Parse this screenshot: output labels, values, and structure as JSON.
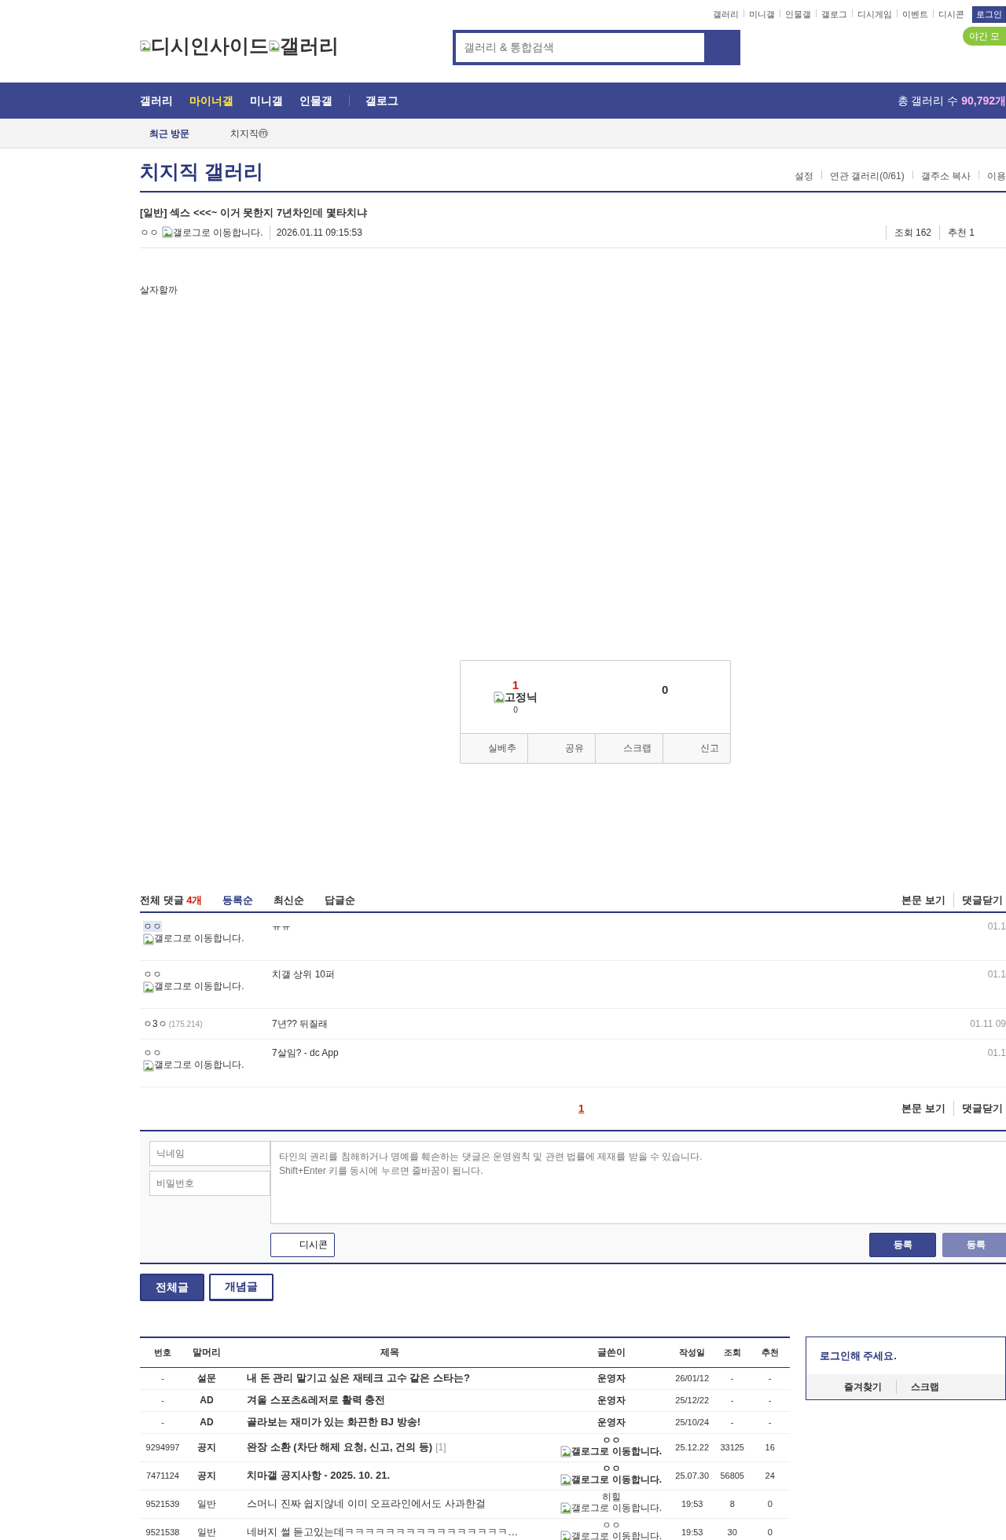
{
  "header": {
    "logo_alt": "디시인사이드",
    "logo_alt_2": "갤러리",
    "search": {
      "placeholder": "갤러리 & 통합검색"
    },
    "top_links": [
      "갤러리",
      "미니갤",
      "인물갤",
      "갤로그",
      "디시게임",
      "이벤트",
      "디시콘"
    ],
    "login": "로그인",
    "night_mode": "야간 모"
  },
  "nav": {
    "items": [
      {
        "label": "갤러리",
        "selected": false
      },
      {
        "label": "마이너갤",
        "selected": true
      },
      {
        "label": "미니갤",
        "selected": false
      },
      {
        "label": "인물갤",
        "selected": false
      },
      {
        "label": "갤로그",
        "selected": false
      }
    ],
    "count_label": "총 갤러리 수",
    "count": "90,792개"
  },
  "recent": {
    "label": "최근 방문",
    "items": [
      "치지직ⓜ"
    ]
  },
  "gallery": {
    "title": "치지직 갤러리",
    "menu": [
      "설정",
      "연관 갤러리(0/61)",
      "갤주소 복사",
      "이용"
    ]
  },
  "post": {
    "title": "[일반] 섹스 <<<~ 이거 못한지 7년차인데 몇타치냐",
    "author": "ㅇㅇ",
    "author_badge": "갤로그로 이동합니다.",
    "date": "2026.01.11 09:15:53",
    "views": "조회 162",
    "recommends": "추천 1",
    "body": "살자할까"
  },
  "recommend": {
    "up_count": "1",
    "fixed_nick": "고정닉",
    "fixed_count": "0",
    "down_count": "0",
    "buttons": [
      "실베추",
      "공유",
      "스크랩",
      "신고"
    ]
  },
  "comments": {
    "total_label": "전체 댓글",
    "count": "4개",
    "sorts": [
      {
        "label": "등록순",
        "selected": true
      },
      {
        "label": "최신순",
        "selected": false
      },
      {
        "label": "답글순",
        "selected": false
      }
    ],
    "links": [
      "본문 보기",
      "댓글닫기"
    ],
    "items": [
      {
        "author": "ㅇㅇ",
        "badge": "갤로그로 이동합니다.",
        "highlighted": true,
        "text": "ㅠㅠ",
        "date": "01.1"
      },
      {
        "author": "ㅇㅇ",
        "badge": "갤로그로 이동합니다.",
        "highlighted": false,
        "text": "치갤 상위 10퍼",
        "date": "01.1"
      },
      {
        "author": "ㅇ3ㅇ",
        "ip": "(175.214)",
        "highlighted": false,
        "text": "7년?? 뒤질래",
        "date": "01.11 09"
      },
      {
        "author": "ㅇㅇ",
        "badge": "갤로그로 이동합니다.",
        "highlighted": false,
        "text": "7살임? - dc App",
        "date": "01.1"
      }
    ],
    "pages": [
      {
        "label": "1",
        "selected": true
      }
    ],
    "bottom_links": [
      "본문 보기",
      "댓글닫기"
    ]
  },
  "form": {
    "nickname": {
      "placeholder": "닉네임"
    },
    "password": {
      "placeholder": "비밀번호"
    },
    "comment": {
      "placeholder": "타인의 권리를 침해하거나 명예를 훼손하는 댓글은 운영원칙 및 관련 법률에 제재를 받을 수 있습니다.\nShift+Enter 키를 동시에 누르면 줄바꿈이 됩니다."
    },
    "dccon": "디시콘",
    "submit": [
      {
        "label": "등록",
        "disabled": false
      },
      {
        "label": "등록",
        "disabled": true
      }
    ]
  },
  "list_tabs": [
    {
      "label": "전체글",
      "selected": true
    },
    {
      "label": "개념글",
      "selected": false
    }
  ],
  "table": {
    "columns": [
      "번호",
      "말머리",
      "제목",
      "글쓴이",
      "작성일",
      "조회",
      "추천"
    ],
    "rows": [
      {
        "kind": "notice",
        "number": "-",
        "subject": "설문",
        "title": "내 돈 관리 맡기고 싶은 재테크 고수 같은 스타는?",
        "writer": "운영자",
        "date": "26/01/12",
        "views": "-",
        "recs": "-"
      },
      {
        "kind": "notice",
        "number": "-",
        "subject": "AD",
        "title": "겨울 스포츠&레저로 활력 충전",
        "writer": "운영자",
        "date": "25/12/22",
        "views": "-",
        "recs": "-"
      },
      {
        "kind": "notice",
        "number": "-",
        "subject": "AD",
        "title": "골라보는 재미가 있는 화끈한 BJ 방송!",
        "writer": "운영자",
        "date": "25/10/24",
        "views": "-",
        "recs": "-"
      },
      {
        "kind": "notice",
        "number": "9294997",
        "subject": "공지",
        "title": "완장 소환 (차단 해제 요청, 신고, 건의 등)",
        "reply_count": "[1]",
        "writer": "ㅇㅇ",
        "writer_badge": "갤로그로 이동합니다.",
        "date": "25.12.22",
        "views": "33125",
        "recs": "16"
      },
      {
        "kind": "notice",
        "number": "7471124",
        "subject": "공지",
        "title": "치마갤 공지사항 - 2025. 10. 21.",
        "writer": "ㅇㅇ",
        "writer_badge": "갤로그로 이동합니다.",
        "date": "25.07.30",
        "views": "56805",
        "recs": "24"
      },
      {
        "kind": "normal",
        "number": "9521539",
        "subject": "일반",
        "title": "스머니 진짜 쉽지않네 이미 오프라인에서도 사과한걸",
        "writer": "히힐",
        "writer_badge": "갤로그로 이동합니다.",
        "date": "19:53",
        "views": "8",
        "recs": "0"
      },
      {
        "kind": "normal",
        "number": "9521538",
        "subject": "일반",
        "title": "네버지 썰 듣고있는데ㅋㅋㅋㅋㅋㅋㅋㅋㅋㅋㅋㅋㅋㅋㅋㅋ…",
        "writer": "ㅇㅇ",
        "writer_badge": "갤로그로 이동합니다.",
        "date": "19:53",
        "views": "30",
        "recs": "0"
      }
    ]
  },
  "sidebar": {
    "prompt": "로그인해 주세요.",
    "links": [
      "즐겨찾기",
      "스크랩"
    ]
  }
}
